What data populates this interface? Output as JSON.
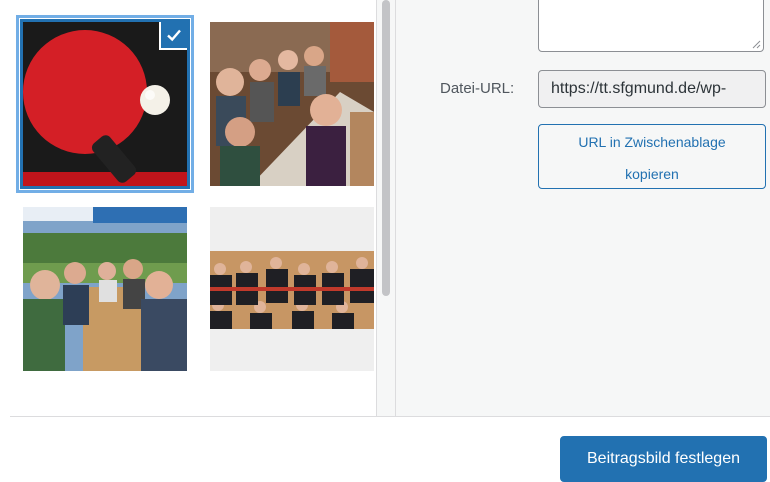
{
  "media_grid": {
    "items": [
      {
        "name": "Tischtennisschläger und Ball",
        "selected": true
      },
      {
        "name": "Gruppe am Tisch in Gaststube",
        "selected": false
      },
      {
        "name": "Gruppe im Biergarten",
        "selected": false
      },
      {
        "name": "Mannschaftsfoto",
        "selected": false
      }
    ]
  },
  "details": {
    "url_label": "Datei-URL:",
    "url_value": "https://tt.sfgmund.de/wp-",
    "copy_button_line1": "URL in Zwischenablage",
    "copy_button_line2": "kopieren"
  },
  "footer": {
    "primary_button": "Beitragsbild festlegen"
  },
  "colors": {
    "accent": "#2271b1",
    "sidebar_bg": "#f6f7f7"
  }
}
